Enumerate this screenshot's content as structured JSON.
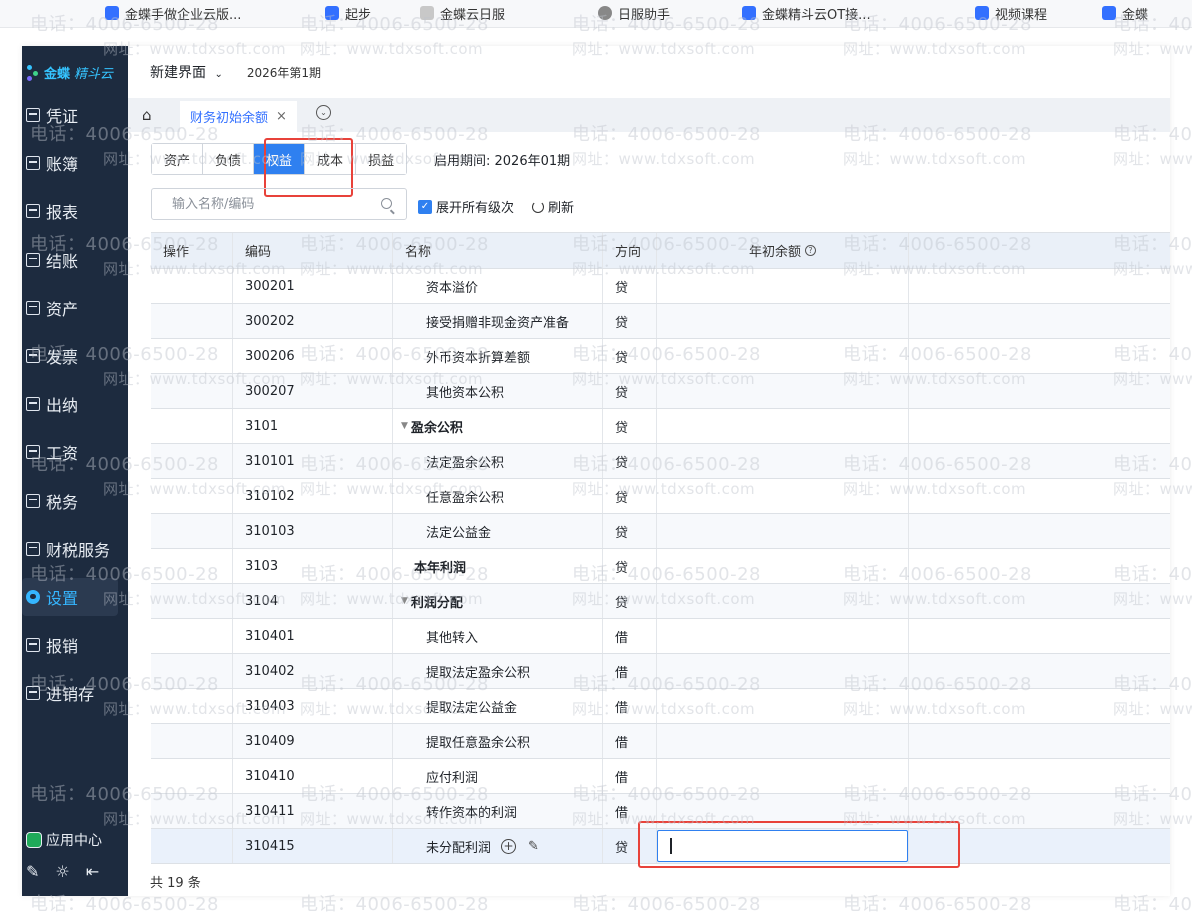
{
  "browser": {
    "bookmarks": [
      "金蝶手做企业云版...",
      "起步",
      "金蝶云日服",
      "日服助手",
      "金蝶精斗云OT接...",
      "视频课程",
      "金蝶"
    ]
  },
  "sidebar": {
    "brand": "金蝶",
    "brand_suffix": "精斗云",
    "items": [
      {
        "label": "凭证"
      },
      {
        "label": "账簿"
      },
      {
        "label": "报表"
      },
      {
        "label": "结账"
      },
      {
        "label": "资产"
      },
      {
        "label": "发票"
      },
      {
        "label": "出纳"
      },
      {
        "label": "工资"
      },
      {
        "label": "税务"
      },
      {
        "label": "财税服务"
      },
      {
        "label": "设置",
        "active": true
      },
      {
        "label": "报销"
      },
      {
        "label": "进销存"
      }
    ],
    "app_center": "应用中心",
    "tool_icons": [
      "✎",
      "☼",
      "⇤"
    ]
  },
  "header": {
    "account_name": "新建界面",
    "period": "2026年第1期"
  },
  "tabs": {
    "home_icon": "⌂",
    "active_label": "财务初始余额",
    "close": "×",
    "more_icon": "⌄"
  },
  "categories": {
    "items": [
      "资产",
      "负债",
      "权益",
      "成本",
      "损益"
    ],
    "selected": "权益",
    "enable_date": "启用期间: 2026年01期"
  },
  "toolbar": {
    "search_placeholder": "输入名称/编码",
    "expand_label": "展开所有级次",
    "expand_checked": true,
    "refresh_label": "刷新"
  },
  "table": {
    "columns": {
      "op": "操作",
      "code": "编码",
      "name": "名称",
      "dir": "方向",
      "amount": "年初余额"
    },
    "rows": [
      {
        "code": "300201",
        "name": "资本溢价",
        "dir": "贷",
        "level": 3
      },
      {
        "code": "300202",
        "name": "接受捐赠非现金资产准备",
        "dir": "贷",
        "level": 3
      },
      {
        "code": "300206",
        "name": "外币资本折算差额",
        "dir": "贷",
        "level": 3
      },
      {
        "code": "300207",
        "name": "其他资本公积",
        "dir": "贷",
        "level": 3
      },
      {
        "code": "3101",
        "name": "盈余公积",
        "dir": "贷",
        "level": 1,
        "expandable": true
      },
      {
        "code": "310101",
        "name": "法定盈余公积",
        "dir": "贷",
        "level": 3
      },
      {
        "code": "310102",
        "name": "任意盈余公积",
        "dir": "贷",
        "level": 3
      },
      {
        "code": "310103",
        "name": "法定公益金",
        "dir": "贷",
        "level": 3
      },
      {
        "code": "3103",
        "name": "本年利润",
        "dir": "贷",
        "level": 1
      },
      {
        "code": "3104",
        "name": "利润分配",
        "dir": "贷",
        "level": 1,
        "expandable": true
      },
      {
        "code": "310401",
        "name": "其他转入",
        "dir": "借",
        "level": 3
      },
      {
        "code": "310402",
        "name": "提取法定盈余公积",
        "dir": "借",
        "level": 3
      },
      {
        "code": "310403",
        "name": "提取法定公益金",
        "dir": "借",
        "level": 3
      },
      {
        "code": "310409",
        "name": "提取任意盈余公积",
        "dir": "借",
        "level": 3
      },
      {
        "code": "310410",
        "name": "应付利润",
        "dir": "借",
        "level": 3
      },
      {
        "code": "310411",
        "name": "转作资本的利润",
        "dir": "借",
        "level": 3
      },
      {
        "code": "310415",
        "name": "未分配利润",
        "dir": "贷",
        "level": 3,
        "editing": true
      }
    ],
    "editing_value": ""
  },
  "footer": {
    "total": "共 19 条"
  },
  "watermark": {
    "phone": "电话：4006-6500-28",
    "site": "网址：www.tdxsoft.com"
  },
  "colors": {
    "accent": "#2f80f0",
    "sidebar_bg": "#1d2b3f",
    "highlight": "#e8423a",
    "brand": "#35c4ff"
  }
}
